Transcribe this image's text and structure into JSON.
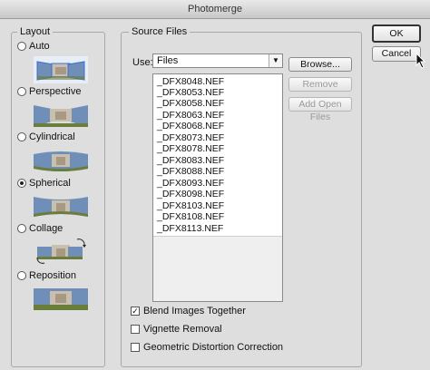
{
  "window": {
    "title": "Photomerge"
  },
  "layout": {
    "group_label": "Layout",
    "options": [
      {
        "label": "Auto",
        "checked": false
      },
      {
        "label": "Perspective",
        "checked": false
      },
      {
        "label": "Cylindrical",
        "checked": false
      },
      {
        "label": "Spherical",
        "checked": true
      },
      {
        "label": "Collage",
        "checked": false
      },
      {
        "label": "Reposition",
        "checked": false
      }
    ]
  },
  "source": {
    "group_label": "Source Files",
    "use_label": "Use:",
    "use_value": "Files",
    "files": [
      "_DFX8048.NEF",
      "_DFX8053.NEF",
      "_DFX8058.NEF",
      "_DFX8063.NEF",
      "_DFX8068.NEF",
      "_DFX8073.NEF",
      "_DFX8078.NEF",
      "_DFX8083.NEF",
      "_DFX8088.NEF",
      "_DFX8093.NEF",
      "_DFX8098.NEF",
      "_DFX8103.NEF",
      "_DFX8108.NEF",
      "_DFX8113.NEF"
    ],
    "browse_label": "Browse...",
    "remove_label": "Remove",
    "add_open_label": "Add Open Files"
  },
  "options": {
    "blend_label": "Blend Images Together",
    "blend_checked": true,
    "vignette_label": "Vignette Removal",
    "vignette_checked": false,
    "geometric_label": "Geometric Distortion Correction",
    "geometric_checked": false
  },
  "actions": {
    "ok_label": "OK",
    "cancel_label": "Cancel"
  },
  "colors": {
    "sky": "#6f8fb8",
    "building": "#c9bfae",
    "lawn": "#6a7d3a",
    "frame": "#3b6fd1"
  }
}
